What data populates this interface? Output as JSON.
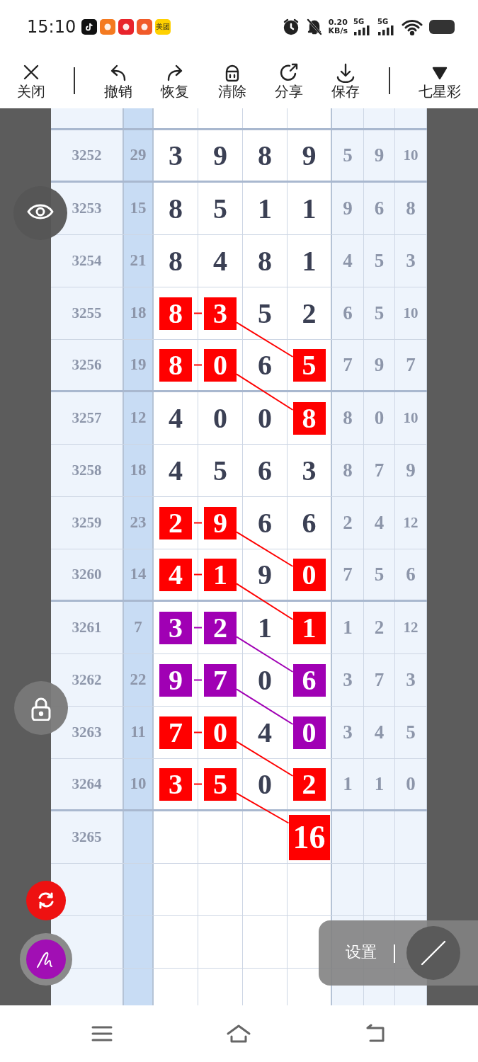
{
  "status_bar": {
    "time": "15:10",
    "app_icon_text": "美团",
    "speed": "0.20",
    "speed_unit": "KB/s",
    "signals": [
      "5G",
      "5G"
    ]
  },
  "toolbar": {
    "items": [
      {
        "label": "关闭"
      },
      {
        "label": "撤销"
      },
      {
        "label": "恢复"
      },
      {
        "label": "清除"
      },
      {
        "label": "分享"
      },
      {
        "label": "保存"
      },
      {
        "label": "七星彩"
      }
    ]
  },
  "table": {
    "rows": [
      {
        "period": "3252",
        "sum": "29",
        "digits": [
          {
            "text": "3"
          },
          {
            "text": "9"
          },
          {
            "text": "8"
          },
          {
            "text": "9"
          }
        ],
        "extra": [
          "5",
          "9",
          "10"
        ]
      },
      {
        "period": "3253",
        "sum": "15",
        "digits": [
          {
            "text": "8"
          },
          {
            "text": "5"
          },
          {
            "text": "1"
          },
          {
            "text": "1"
          }
        ],
        "extra": [
          "9",
          "6",
          "8"
        ]
      },
      {
        "period": "3254",
        "sum": "21",
        "digits": [
          {
            "text": "8"
          },
          {
            "text": "4"
          },
          {
            "text": "8"
          },
          {
            "text": "1"
          }
        ],
        "extra": [
          "4",
          "5",
          "3"
        ]
      },
      {
        "period": "3255",
        "sum": "18",
        "digits": [
          {
            "text": "8",
            "color": "#ff0000"
          },
          {
            "text": "3",
            "color": "#ff0000"
          },
          {
            "text": "5"
          },
          {
            "text": "2"
          }
        ],
        "extra": [
          "6",
          "5",
          "10"
        ]
      },
      {
        "period": "3256",
        "sum": "19",
        "digits": [
          {
            "text": "8",
            "color": "#ff0000"
          },
          {
            "text": "0",
            "color": "#ff0000"
          },
          {
            "text": "6"
          },
          {
            "text": "5",
            "color": "#ff0000"
          }
        ],
        "extra": [
          "7",
          "9",
          "7"
        ]
      },
      {
        "period": "3257",
        "sum": "12",
        "digits": [
          {
            "text": "4"
          },
          {
            "text": "0"
          },
          {
            "text": "0"
          },
          {
            "text": "8",
            "color": "#ff0000"
          }
        ],
        "extra": [
          "8",
          "0",
          "10"
        ]
      },
      {
        "period": "3258",
        "sum": "18",
        "digits": [
          {
            "text": "4"
          },
          {
            "text": "5"
          },
          {
            "text": "6"
          },
          {
            "text": "3"
          }
        ],
        "extra": [
          "8",
          "7",
          "9"
        ]
      },
      {
        "period": "3259",
        "sum": "23",
        "digits": [
          {
            "text": "2",
            "color": "#ff0000"
          },
          {
            "text": "9",
            "color": "#ff0000"
          },
          {
            "text": "6"
          },
          {
            "text": "6"
          }
        ],
        "extra": [
          "2",
          "4",
          "12"
        ]
      },
      {
        "period": "3260",
        "sum": "14",
        "digits": [
          {
            "text": "4",
            "color": "#ff0000"
          },
          {
            "text": "1",
            "color": "#ff0000"
          },
          {
            "text": "9"
          },
          {
            "text": "0",
            "color": "#ff0000"
          }
        ],
        "extra": [
          "7",
          "5",
          "6"
        ]
      },
      {
        "period": "3261",
        "sum": "7",
        "digits": [
          {
            "text": "3",
            "color": "#a000b4"
          },
          {
            "text": "2",
            "color": "#a000b4"
          },
          {
            "text": "1"
          },
          {
            "text": "1",
            "color": "#ff0000"
          }
        ],
        "extra": [
          "1",
          "2",
          "12"
        ]
      },
      {
        "period": "3262",
        "sum": "22",
        "digits": [
          {
            "text": "9",
            "color": "#a000b4"
          },
          {
            "text": "7",
            "color": "#a000b4"
          },
          {
            "text": "0"
          },
          {
            "text": "6",
            "color": "#a000b4"
          }
        ],
        "extra": [
          "3",
          "7",
          "3"
        ]
      },
      {
        "period": "3263",
        "sum": "11",
        "digits": [
          {
            "text": "7",
            "color": "#ff0000"
          },
          {
            "text": "0",
            "color": "#ff0000"
          },
          {
            "text": "4"
          },
          {
            "text": "0",
            "color": "#a000b4"
          }
        ],
        "extra": [
          "3",
          "4",
          "5"
        ]
      },
      {
        "period": "3264",
        "sum": "10",
        "digits": [
          {
            "text": "3",
            "color": "#ff0000"
          },
          {
            "text": "5",
            "color": "#ff0000"
          },
          {
            "text": "0"
          },
          {
            "text": "2",
            "color": "#ff0000"
          }
        ],
        "extra": [
          "1",
          "1",
          "0"
        ]
      },
      {
        "period": "3265",
        "kind": "forecast",
        "forecast": {
          "text": "16",
          "color": "#ff0000"
        }
      }
    ]
  },
  "settings_panel": {
    "label": "设置"
  }
}
